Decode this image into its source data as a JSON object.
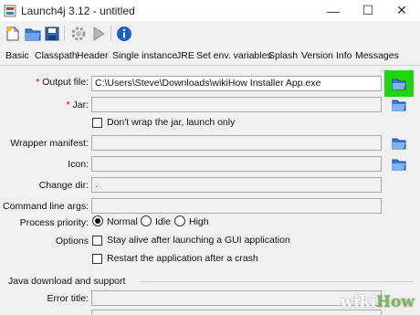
{
  "window": {
    "title": "Launch4j 3.12 - untitled",
    "controls": {
      "minimize": "—",
      "maximize": "☐",
      "close": "✕"
    }
  },
  "toolbar": {
    "icons": [
      "new-file-icon",
      "open-folder-icon",
      "save-icon",
      "gear-icon",
      "run-icon",
      "info-icon"
    ]
  },
  "tabs": [
    "Basic",
    "Classpath",
    "Header",
    "Single instance",
    "JRE",
    "Set env. variables",
    "Splash",
    "Version Info",
    "Messages"
  ],
  "form": {
    "output_file": {
      "label": "Output file:",
      "required": "*",
      "value": "C:\\Users\\Steve\\Downloads\\wikiHow Installer App.exe"
    },
    "jar": {
      "label": "Jar:",
      "required": "*",
      "value": ""
    },
    "dont_wrap": {
      "label": "Don't wrap the jar, launch only",
      "checked": false
    },
    "wrapper_manifest": {
      "label": "Wrapper manifest:",
      "value": ""
    },
    "icon": {
      "label": "Icon:",
      "value": ""
    },
    "change_dir": {
      "label": "Change dir:",
      "value": "."
    },
    "command_line_args": {
      "label": "Command line args:",
      "value": ""
    },
    "process_priority": {
      "label": "Process priority:",
      "options": [
        "Normal",
        "Idle",
        "High"
      ],
      "selected": "Normal"
    },
    "options": {
      "label": "Options",
      "stay_alive": "Stay alive after launching a GUI application",
      "restart": "Restart the application after a crash"
    },
    "java_download": {
      "section_title": "Java download and support",
      "error_title_label": "Error title:",
      "error_title_value": ""
    }
  },
  "colors": {
    "highlight": "#22d30f",
    "required": "#d40000",
    "folder": "#3a7bd5"
  },
  "watermark": {
    "part1": "wiki",
    "part2": "How"
  }
}
